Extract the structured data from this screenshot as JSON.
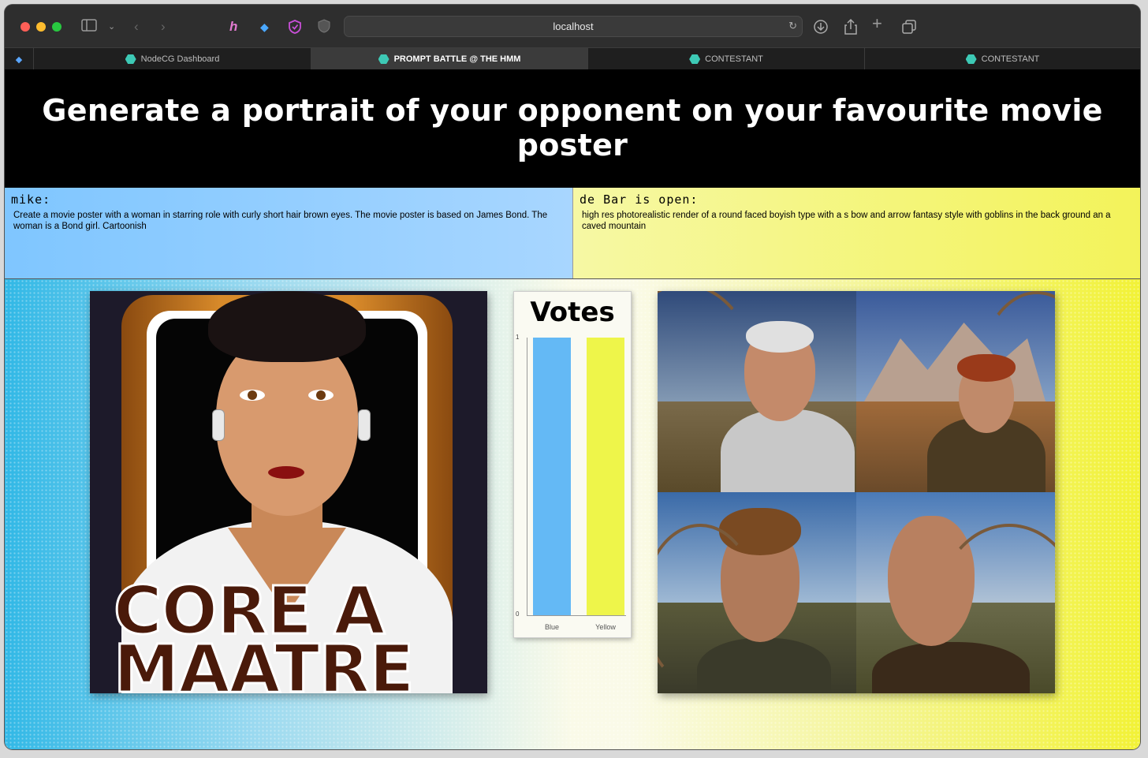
{
  "browser": {
    "address": "localhost",
    "tabs": [
      {
        "label": "NodeCG Dashboard",
        "active": false
      },
      {
        "label": "PROMPT BATTLE @ THE HMM",
        "active": true
      },
      {
        "label": "CONTESTANT",
        "active": false
      },
      {
        "label": "CONTESTANT",
        "active": false
      }
    ]
  },
  "page": {
    "title": "Generate a portrait of your opponent on your favourite movie poster"
  },
  "contestants": [
    {
      "name": "mike:",
      "prompt": "Create a movie poster with a woman in starring role with curly short hair brown eyes. The movie poster is based on James Bond. The woman is a Bond girl. Cartoonish",
      "color": "#7fc6ff"
    },
    {
      "name": "de Bar is open:",
      "prompt": "high res photorealistic render of a round faced boyish type with a s bow and arrow fantasy style with goblins in the back ground an a caved mountain",
      "color": "#f3f35a"
    }
  ],
  "poster": {
    "text_line1": "CORE A",
    "text_line2": "MAATRE"
  },
  "votes": {
    "title": "Votes",
    "tick_top": "1",
    "tick_bottom": "0"
  },
  "chart_data": {
    "type": "bar",
    "title": "Votes",
    "categories": [
      "Blue",
      "Yellow"
    ],
    "values": [
      1,
      1
    ],
    "ylim": [
      0,
      1
    ],
    "colors": [
      "#64b9f5",
      "#eef54a"
    ]
  }
}
